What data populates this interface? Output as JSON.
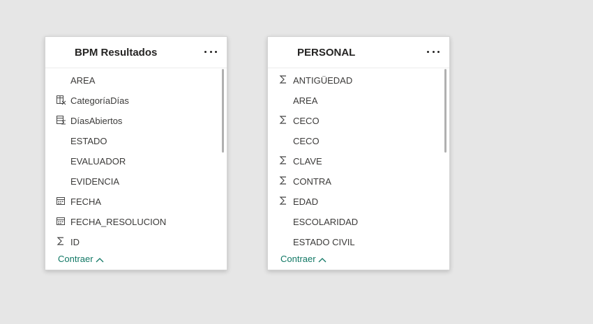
{
  "tables": [
    {
      "title": "BPM Resultados",
      "fields": [
        {
          "icon": "none",
          "name": "AREA"
        },
        {
          "icon": "calculated-column-icon",
          "name": "CategoríaDías"
        },
        {
          "icon": "calculated-measure-icon",
          "name": "DíasAbiertos"
        },
        {
          "icon": "none",
          "name": "ESTADO"
        },
        {
          "icon": "none",
          "name": "EVALUADOR"
        },
        {
          "icon": "none",
          "name": "EVIDENCIA"
        },
        {
          "icon": "calendar-icon",
          "name": "FECHA"
        },
        {
          "icon": "calendar-icon",
          "name": "FECHA_RESOLUCION"
        },
        {
          "icon": "sigma-icon",
          "name": "ID"
        }
      ],
      "collapse_label": "Contraer"
    },
    {
      "title": "PERSONAL",
      "fields": [
        {
          "icon": "sigma-icon",
          "name": "ANTIGÜEDAD"
        },
        {
          "icon": "none",
          "name": "AREA"
        },
        {
          "icon": "sigma-icon",
          "name": "CECO"
        },
        {
          "icon": "none",
          "name": "CECO"
        },
        {
          "icon": "sigma-icon",
          "name": "CLAVE"
        },
        {
          "icon": "sigma-icon",
          "name": "CONTRA"
        },
        {
          "icon": "sigma-icon",
          "name": "EDAD"
        },
        {
          "icon": "none",
          "name": "ESCOLARIDAD"
        },
        {
          "icon": "none",
          "name": "ESTADO CIVIL"
        }
      ],
      "collapse_label": "Contraer"
    }
  ],
  "colors": {
    "accent": "#117865",
    "background": "#e6e6e6"
  }
}
